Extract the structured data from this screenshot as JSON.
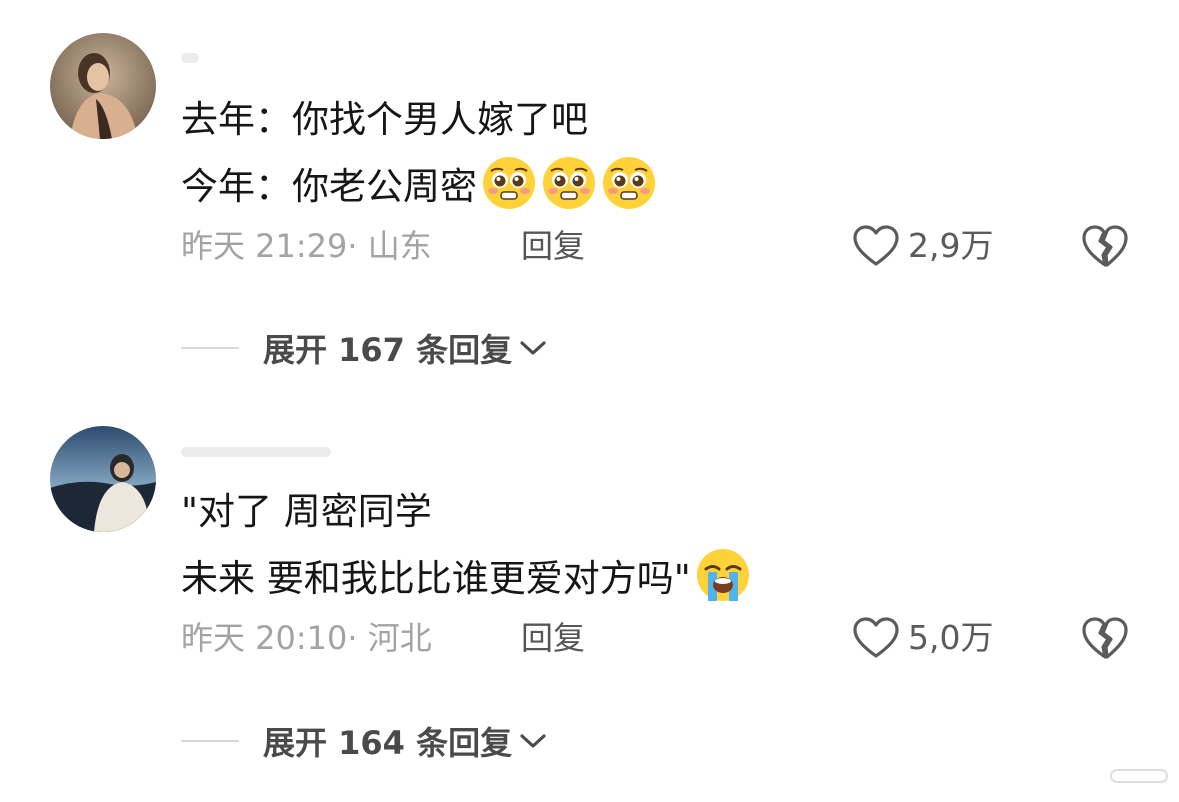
{
  "comments": [
    {
      "username": "",
      "lines": [
        "去年：你找个男人嫁了吧",
        "今年：你老公周密"
      ],
      "emojis": [
        "pleading-face-icon",
        "pleading-face-icon",
        "pleading-face-icon"
      ],
      "time": "昨天 21:29",
      "location": "· 山东",
      "reply_label": "回复",
      "likes": "2,9万",
      "expand_label": "展开 167 条回复"
    },
    {
      "username": "",
      "lines": [
        "\"对了 周密同学",
        "未来 要和我比比谁更爱对方吗\""
      ],
      "emojis": [
        "loudly-crying-face-icon"
      ],
      "time": "昨天 20:10",
      "location": "· 河北",
      "reply_label": "回复",
      "likes": "5,0万",
      "expand_label": "展开 164 条回复"
    }
  ],
  "colors": {
    "background": "#ffffff",
    "text": "#161616",
    "meta": "#a3a3a3",
    "icon": "#5b5b5b"
  }
}
